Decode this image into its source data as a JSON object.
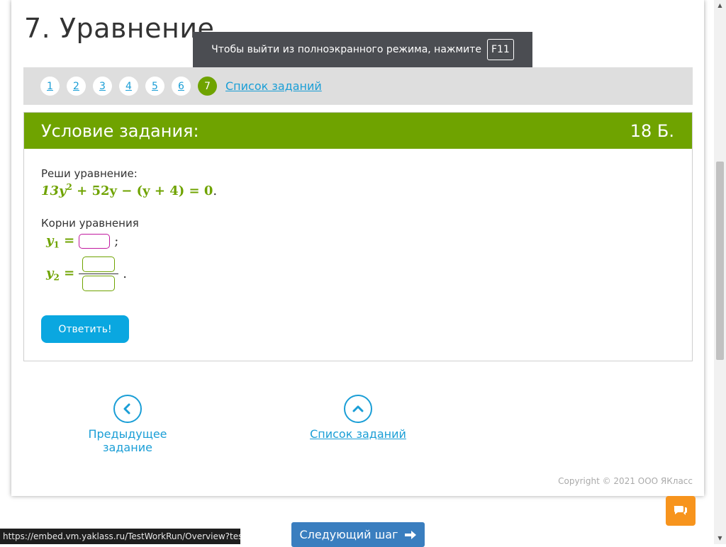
{
  "page": {
    "title": "7. Уравнение"
  },
  "fullscreen_notice": {
    "text": "Чтобы выйти из полноэкранного режима, нажмите",
    "key": "F11"
  },
  "task_nav": {
    "numbers": [
      "1",
      "2",
      "3",
      "4",
      "5",
      "6",
      "7"
    ],
    "active": "7",
    "list_link": "Список заданий"
  },
  "task": {
    "header": "Условие задания:",
    "points": "18 Б.",
    "prompt": "Реши уравнение:",
    "equation": {
      "left": "13y",
      "power": "2",
      "rest": " + 52y − (y + 4) = 0",
      "end": "."
    },
    "roots_label": "Корни уравнения",
    "y1": {
      "var": "y",
      "sub": "1",
      "eq": "=",
      "value": "",
      "sep": ";"
    },
    "y2": {
      "var": "y",
      "sub": "2",
      "eq": "=",
      "numerator": "",
      "denominator": "",
      "end": "."
    },
    "answer_button": "Ответить!"
  },
  "bottom_nav": {
    "prev_label": "Предыдущее задание",
    "list_label": "Список заданий"
  },
  "footer": {
    "copyright": "Copyright © 2021 ООО ЯКласс"
  },
  "next_step": {
    "label": "Следующий шаг"
  },
  "status_bar": {
    "url": "https://embed.vm.yaklass.ru/TestWorkRun/Overview?testRes..."
  },
  "colors": {
    "accent_green": "#6fa300",
    "link_blue": "#1a9ed6",
    "button_blue": "#0aa7e0",
    "chat_orange": "#f7941d",
    "next_blue": "#3a7ebf"
  }
}
